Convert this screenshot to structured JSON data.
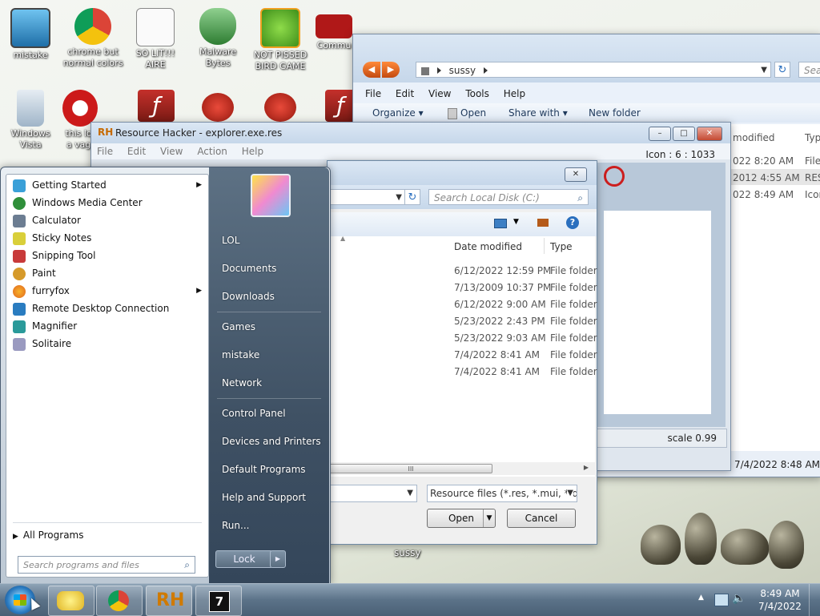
{
  "desktop": {
    "icons": [
      {
        "label": "mistake",
        "color": "#3a9bd6"
      },
      {
        "label": "chrome but normal colors",
        "color": "#e8b923"
      },
      {
        "label": "SO LIT!!! AIRE",
        "color": "#d0d0d0"
      },
      {
        "label": "Malware Bytes",
        "color": "#2e8b3a"
      },
      {
        "label": "NOT PISSED BIRD GAME",
        "color": "#6cbf2a"
      },
      {
        "label": "Commu",
        "color": "#b01818"
      },
      {
        "label": "Windows Vista",
        "color": "#9fb4c8"
      },
      {
        "label": "this lo a vag",
        "color": "#cc1a1a"
      }
    ]
  },
  "explorer_back": {
    "address": "sussy",
    "search_placeholder": "Sea",
    "menu": [
      "File",
      "Edit",
      "View",
      "Tools",
      "Help"
    ],
    "toolbar": {
      "organize": "Organize",
      "open": "Open",
      "share_with": "Share with",
      "new_folder": "New folder"
    },
    "col_modified": "modified",
    "col_type": "Typ",
    "rows": [
      {
        "date": "022 8:20 AM",
        "type": "File"
      },
      {
        "date": "2012 4:55 AM",
        "type": "RES"
      },
      {
        "date": "022 8:49 AM",
        "type": "Icon"
      }
    ],
    "bottom_date": "7/4/2022 8:48 AM",
    "label_sussy": "sussy"
  },
  "resource_hacker": {
    "title": "Resource Hacker - explorer.exe.res",
    "menu": [
      "File",
      "Edit",
      "View",
      "Action",
      "Help"
    ],
    "icon_info": "Icon : 6 : 1033",
    "scale": "scale 0.99"
  },
  "open_dialog": {
    "search_placeholder": "Search Local Disk (C:)",
    "col_date": "Date modified",
    "col_type": "Type",
    "rows": [
      {
        "date": "6/12/2022 12:59 PM",
        "type": "File folder"
      },
      {
        "date": "7/13/2009 10:37 PM",
        "type": "File folder"
      },
      {
        "date": "6/12/2022 9:00 AM",
        "type": "File folder"
      },
      {
        "date": "5/23/2022 2:43 PM",
        "type": "File folder"
      },
      {
        "date": "5/23/2022 9:03 AM",
        "type": "File folder"
      },
      {
        "date": "7/4/2022 8:41 AM",
        "type": "File folder"
      },
      {
        "date": "7/4/2022 8:41 AM",
        "type": "File folder"
      }
    ],
    "filter": "Resource files (*.res, *.mui, *.dll",
    "open_button": "Open",
    "cancel_button": "Cancel",
    "scroll_grip": "III"
  },
  "start_menu": {
    "programs": [
      {
        "label": "Getting Started",
        "color": "#3aa0d8",
        "submenu": true
      },
      {
        "label": "Windows Media Center",
        "color": "#2f8f3a",
        "submenu": false
      },
      {
        "label": "Calculator",
        "color": "#6c7d92",
        "submenu": false
      },
      {
        "label": "Sticky Notes",
        "color": "#d9cf3a",
        "submenu": false
      },
      {
        "label": "Snipping Tool",
        "color": "#c83a3a",
        "submenu": false
      },
      {
        "label": "Paint",
        "color": "#d69a2a",
        "submenu": false
      },
      {
        "label": "furryfox",
        "color": "#e0661e",
        "submenu": true
      },
      {
        "label": "Remote Desktop Connection",
        "color": "#2a7cc0",
        "submenu": false
      },
      {
        "label": "Magnifier",
        "color": "#2a9a9a",
        "submenu": false
      },
      {
        "label": "Solitaire",
        "color": "#9a9ac0",
        "submenu": false
      }
    ],
    "all_programs": "All Programs",
    "search_placeholder": "Search programs and files",
    "right_links": [
      "LOL",
      "Documents",
      "Downloads",
      "Games",
      "mistake",
      "Network",
      "Control Panel",
      "Devices and Printers",
      "Default Programs",
      "Help and Support",
      "Run..."
    ],
    "lock_label": "Lock"
  },
  "taskbar": {
    "time": "8:49 AM",
    "date": "7/4/2022",
    "rh_label": "RH",
    "seven_label": "7"
  }
}
